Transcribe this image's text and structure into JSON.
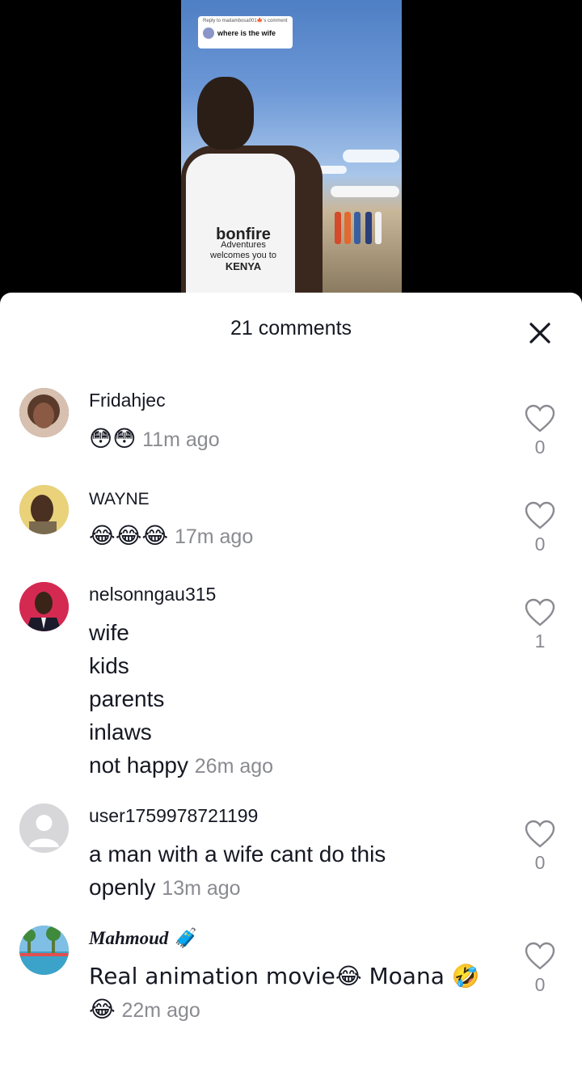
{
  "video": {
    "reply_to": "Reply to madambosa001🍁's comment",
    "reply_text": "where is the wife",
    "shirt_brand": "bonfire",
    "shirt_line1": "Adventures",
    "shirt_line2": "welcomes you to",
    "shirt_line3": "KENYA"
  },
  "header": {
    "comment_count": "21 comments",
    "close_icon": "close-icon"
  },
  "comments": [
    {
      "username": "Fridahjec",
      "text": "😳😳",
      "time": "11m ago",
      "likes": "0",
      "avatar_color": "#6b4a3a"
    },
    {
      "username": "WAYNE",
      "text": "😂😂😂",
      "time": "17m ago",
      "likes": "0",
      "avatar_color": "#c8a45a"
    },
    {
      "username": "nelsonngau315",
      "lines": [
        "wife",
        "kids",
        "parents",
        "inlaws",
        "not happy"
      ],
      "time": "26m ago",
      "likes": "1",
      "avatar_color": "#d32f4f"
    },
    {
      "username": "user1759978721199",
      "lines": [
        "a man with a wife cant do this",
        "openly"
      ],
      "time": "13m ago",
      "likes": "0",
      "avatar_color": "#d9d9dc"
    },
    {
      "username": "Mahmoud 🧳",
      "lines": [
        "Real animation movie😂 Moana 🤣",
        "😂"
      ],
      "time": "22m ago",
      "likes": "0",
      "avatar_color": "#4e9c5a"
    }
  ],
  "colors": {
    "text_primary": "#161823",
    "text_secondary": "#8a8b91",
    "sheet_bg": "#ffffff"
  }
}
